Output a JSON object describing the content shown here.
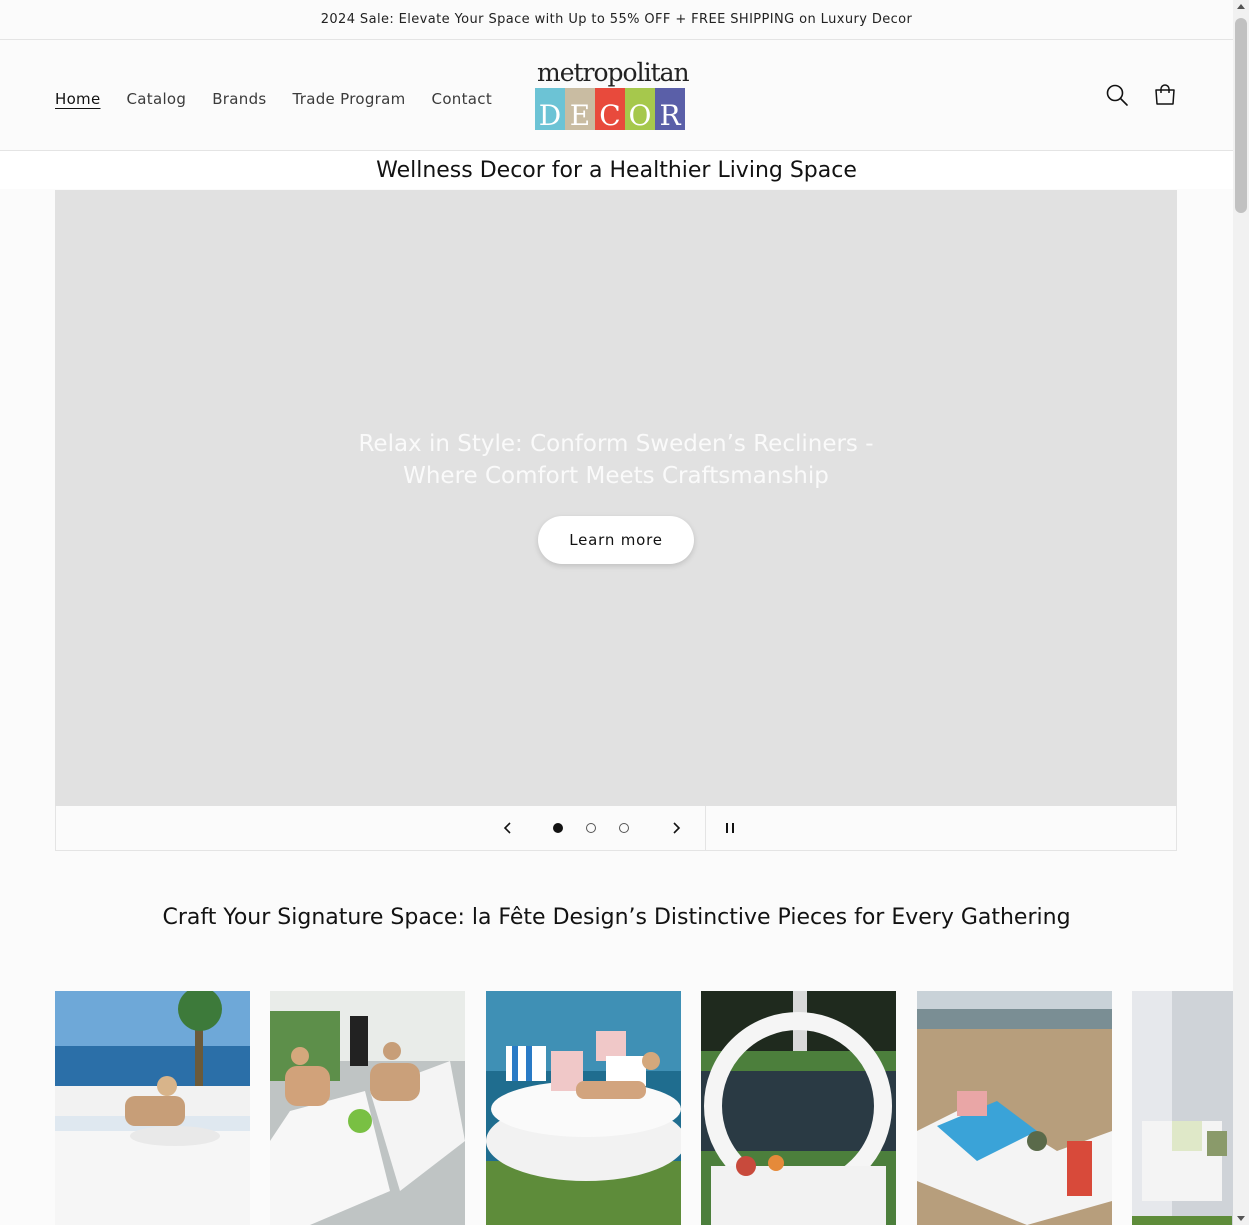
{
  "announcement": {
    "text": "2024 Sale: Elevate Your Space with Up to 55% OFF + FREE SHIPPING on Luxury Decor"
  },
  "nav": {
    "items": [
      {
        "label": "Home",
        "active": true
      },
      {
        "label": "Catalog"
      },
      {
        "label": "Brands"
      },
      {
        "label": "Trade Program"
      },
      {
        "label": "Contact"
      }
    ]
  },
  "logo": {
    "word": "metropolitan",
    "tiles": [
      {
        "letter": "D",
        "color": "#6cc3d5"
      },
      {
        "letter": "E",
        "color": "#c9bca2"
      },
      {
        "letter": "C",
        "color": "#e84a3c"
      },
      {
        "letter": "O",
        "color": "#a6c84c"
      },
      {
        "letter": "R",
        "color": "#5a5fa8"
      }
    ]
  },
  "header_icons": {
    "search": "search-icon",
    "cart": "cart-icon"
  },
  "subtitle": {
    "text": "Wellness Decor for a Healthier Living Space"
  },
  "hero": {
    "heading_line1": "Relax in Style: Conform Sweden’s Recliners -",
    "heading_line2": "Where Comfort Meets Craftsmanship",
    "button": "Learn more",
    "background": "#e1e1e1"
  },
  "slider": {
    "prev_icon": "chevron-left-icon",
    "next_icon": "chevron-right-icon",
    "pause_icon": "pause-icon",
    "dots": [
      {
        "active": true
      },
      {
        "active": false
      },
      {
        "active": false
      }
    ]
  },
  "collection": {
    "title": "Craft Your Signature Space: la Fête Design’s Distinctive Pieces for Every Gathering",
    "products": [
      {
        "name": "product-image-1"
      },
      {
        "name": "product-image-2"
      },
      {
        "name": "product-image-3"
      },
      {
        "name": "product-image-4"
      },
      {
        "name": "product-image-5"
      },
      {
        "name": "product-image-6"
      }
    ]
  }
}
